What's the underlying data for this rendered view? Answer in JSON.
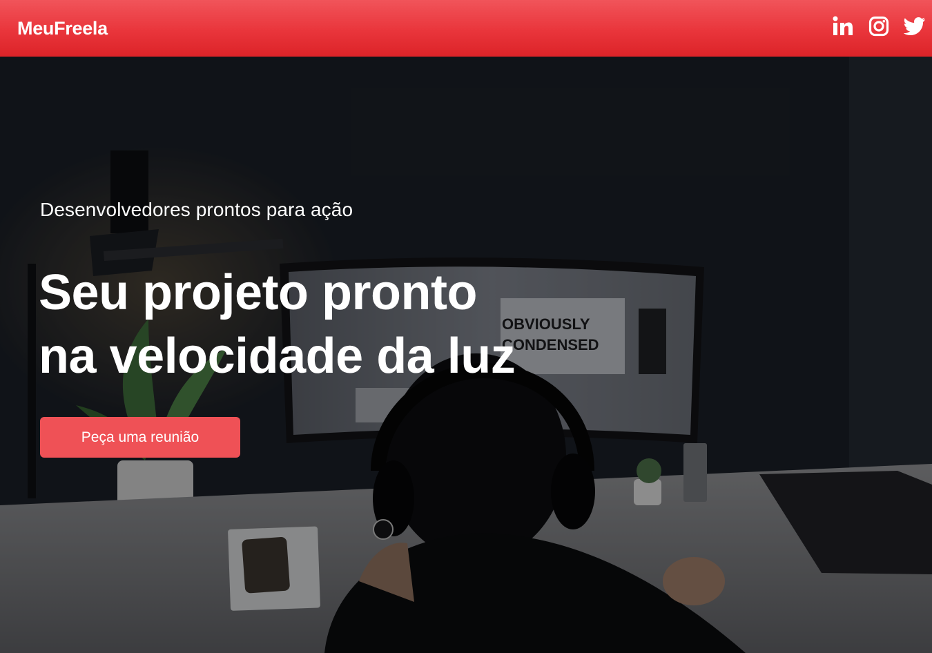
{
  "header": {
    "brand": "MeuFreela",
    "socials": [
      {
        "icon": "linkedin-icon"
      },
      {
        "icon": "instagram-icon"
      },
      {
        "icon": "twitter-icon"
      }
    ]
  },
  "hero": {
    "eyebrow": "Desenvolvedores prontos para ação",
    "headline_line1": "Seu projeto pronto",
    "headline_line2": "na velocidade da luz",
    "cta_label": "Peça uma reunião",
    "background_image": "person-at-desk-photo",
    "monitor_text_line1": "OBVIOUSLY",
    "monitor_text_line2": "CONDENSED"
  },
  "colors": {
    "header_top": "#f1545a",
    "header_bottom": "#dc2328",
    "cta": "#ef5156",
    "text": "#ffffff"
  }
}
